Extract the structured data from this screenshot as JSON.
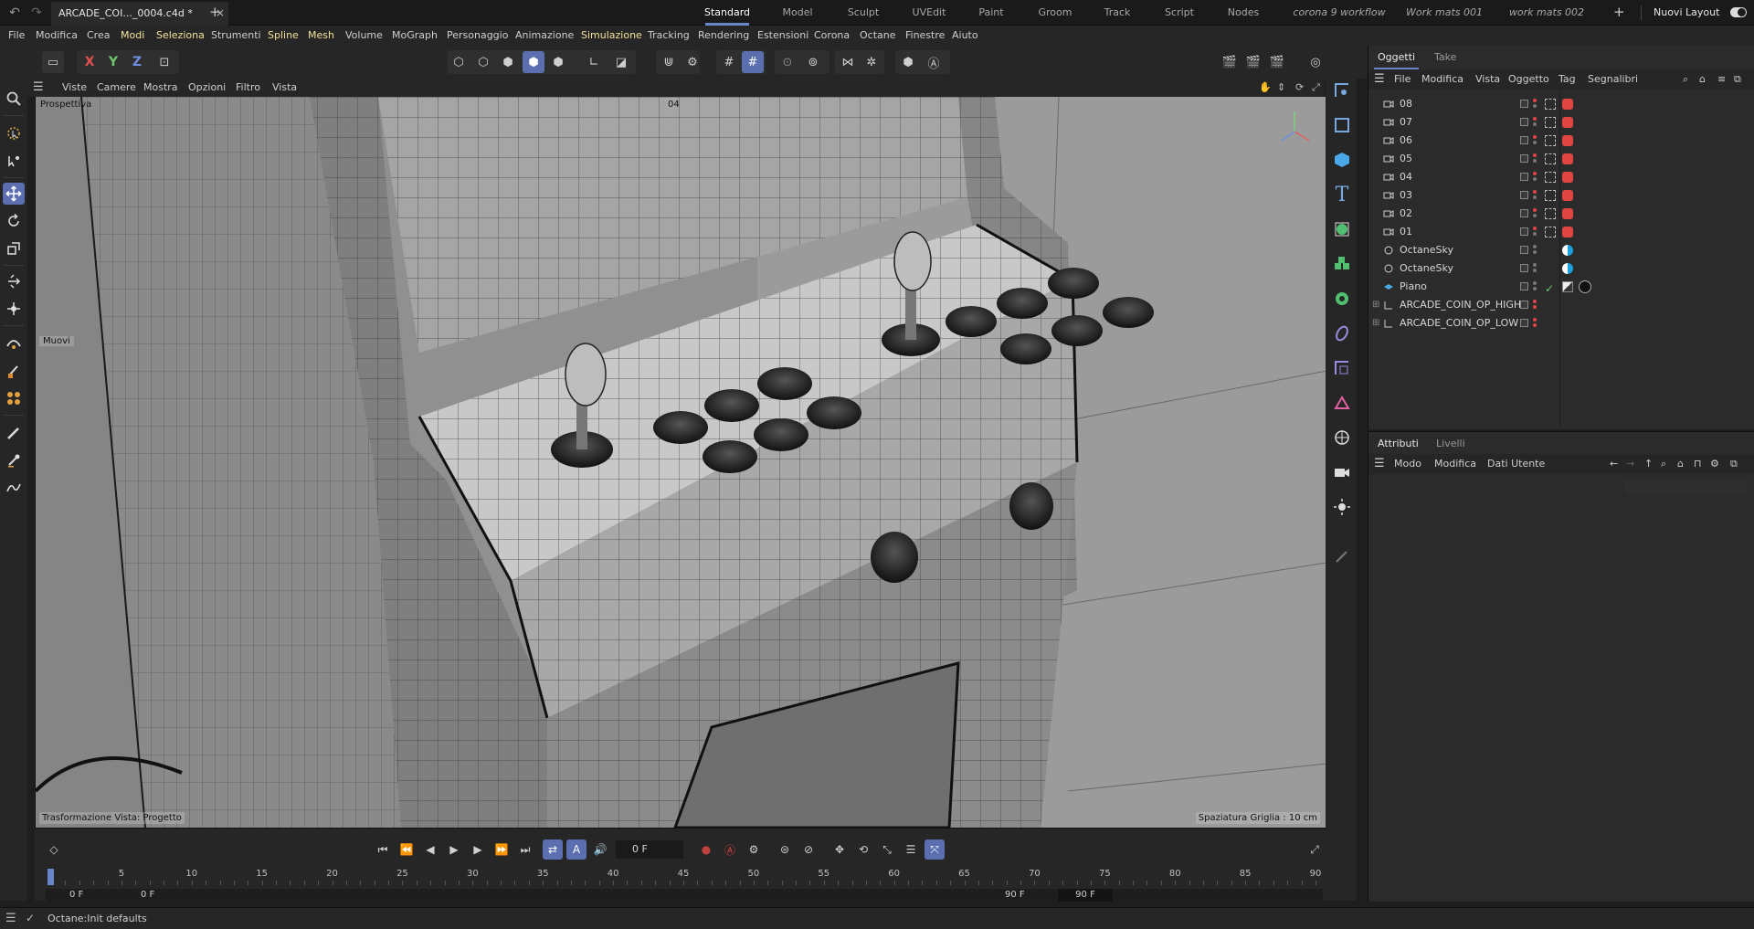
{
  "window": {
    "doc_tab": "ARCADE_COI..._0004.c4d *",
    "close_glyph": "×",
    "add_tab_glyph": "+",
    "layouts": [
      "Standard",
      "Model",
      "Sculpt",
      "UVEdit",
      "Paint",
      "Groom",
      "Track",
      "Script",
      "Nodes",
      "corona 9 workflow",
      "Work mats 001",
      "work mats 002"
    ],
    "active_layout": "Standard",
    "new_layout_label": "Nuovi Layout"
  },
  "menu": [
    "File",
    "Modifica",
    "Crea",
    "Modi",
    "Seleziona",
    "Strumenti",
    "Spline",
    "Mesh",
    "Volume",
    "MoGraph",
    "Personaggio",
    "Animazione",
    "Simulazione",
    "Tracking",
    "Rendering",
    "Estensioni",
    "Corona",
    "Octane",
    "Finestre",
    "Aiuto"
  ],
  "menu_highlighted": [
    "Modi",
    "Seleziona",
    "Spline",
    "Mesh",
    "Simulazione"
  ],
  "toolbar": {
    "axes": [
      "X",
      "Y",
      "Z"
    ]
  },
  "viewport": {
    "menu": [
      "Viste",
      "Camere",
      "Mostra",
      "Opzioni",
      "Filtro",
      "Vista"
    ],
    "label": "Prospettiva",
    "camera": "04",
    "tool_label": "Muovi",
    "transform_label": "Trasformazione Vista: Progetto",
    "grid_label": "Spaziatura Griglia : 10 cm"
  },
  "objects_panel": {
    "tabs": [
      "Oggetti",
      "Take"
    ],
    "menu": [
      "File",
      "Modifica",
      "Vista",
      "Oggetto",
      "Tag",
      "Segnalibri"
    ],
    "rows": [
      {
        "name": "08",
        "kind": "camera"
      },
      {
        "name": "07",
        "kind": "camera"
      },
      {
        "name": "06",
        "kind": "camera"
      },
      {
        "name": "05",
        "kind": "camera"
      },
      {
        "name": "04",
        "kind": "camera"
      },
      {
        "name": "03",
        "kind": "camera"
      },
      {
        "name": "02",
        "kind": "camera"
      },
      {
        "name": "01",
        "kind": "camera"
      },
      {
        "name": "OctaneSky",
        "kind": "sky"
      },
      {
        "name": "OctaneSky",
        "kind": "sky"
      },
      {
        "name": "Piano",
        "kind": "plane"
      },
      {
        "name": "ARCADE_COIN_OP_HIGH",
        "kind": "group"
      },
      {
        "name": "ARCADE_COIN_OP_LOW",
        "kind": "group"
      }
    ]
  },
  "attributes_panel": {
    "tabs": [
      "Attributi",
      "Livelli"
    ],
    "menu": [
      "Modo",
      "Modifica",
      "Dati Utente"
    ]
  },
  "timeline": {
    "current_frame": "0 F",
    "ticks": [
      0,
      5,
      10,
      15,
      20,
      25,
      30,
      35,
      40,
      45,
      50,
      55,
      60,
      65,
      70,
      75,
      80,
      85,
      90
    ],
    "range_start": "0 F",
    "range_start_inner": "0 F",
    "range_end_inner": "90 F",
    "range_end": "90 F",
    "playhead_frame": 0
  },
  "status": {
    "text": "Octane:Init defaults"
  },
  "colors": {
    "accent": "#5b6fb0",
    "highlight_menu": "#f2e39a",
    "tag_red": "#e0453f",
    "sky_blue": "#1aa0e0"
  }
}
